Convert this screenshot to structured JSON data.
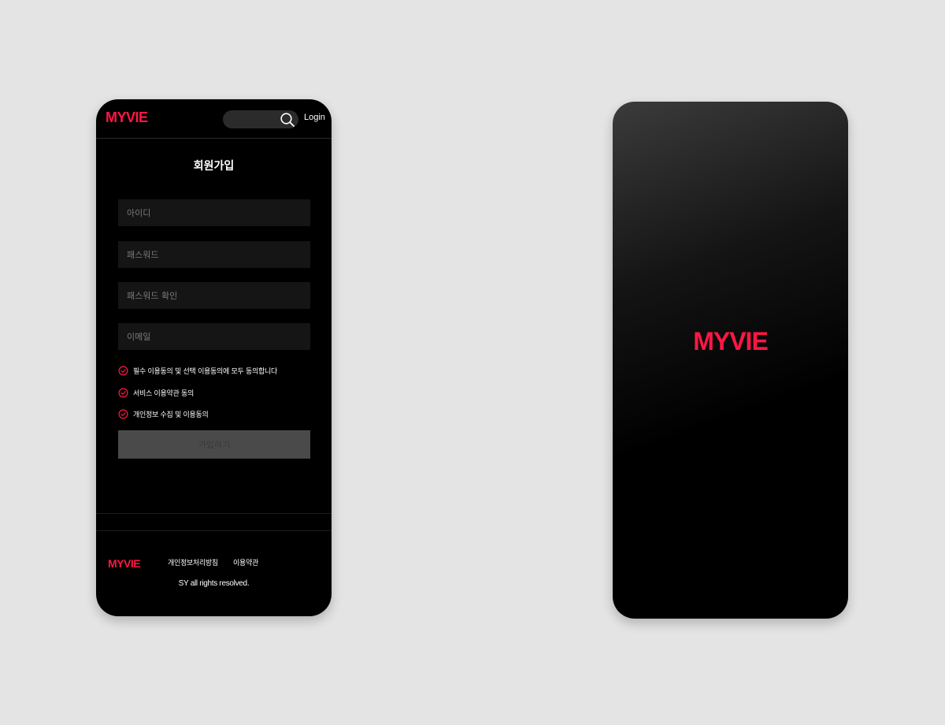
{
  "brand": {
    "name": "MYVIE",
    "accent_color": "#ff1744"
  },
  "header": {
    "logo": "MYVIE",
    "search": {
      "placeholder": "",
      "icon": "search-icon"
    },
    "login_label": "Login"
  },
  "signup": {
    "title": "회원가입",
    "fields": [
      {
        "name": "id",
        "placeholder": "아이디",
        "value": ""
      },
      {
        "name": "password",
        "placeholder": "패스워드",
        "value": ""
      },
      {
        "name": "password_confirm",
        "placeholder": "패스워드 확인",
        "value": ""
      },
      {
        "name": "email",
        "placeholder": "이메일",
        "value": ""
      }
    ],
    "agreements": [
      {
        "label": "필수 이용동의 및 선택 이용동의에 모두 동의합니다",
        "icon": "check-circle-icon"
      },
      {
        "label": "서비스 이용약관 동의",
        "icon": "check-circle-icon"
      },
      {
        "label": "개인정보 수집 및 이용동의",
        "icon": "check-circle-icon"
      }
    ],
    "submit_label": "가입하기"
  },
  "footer": {
    "logo": "MYVIE",
    "links": [
      "개인정보처리방침",
      "이용약관"
    ],
    "copyright": "SY all rights resolved."
  },
  "splash": {
    "logo": "MYVIE"
  }
}
